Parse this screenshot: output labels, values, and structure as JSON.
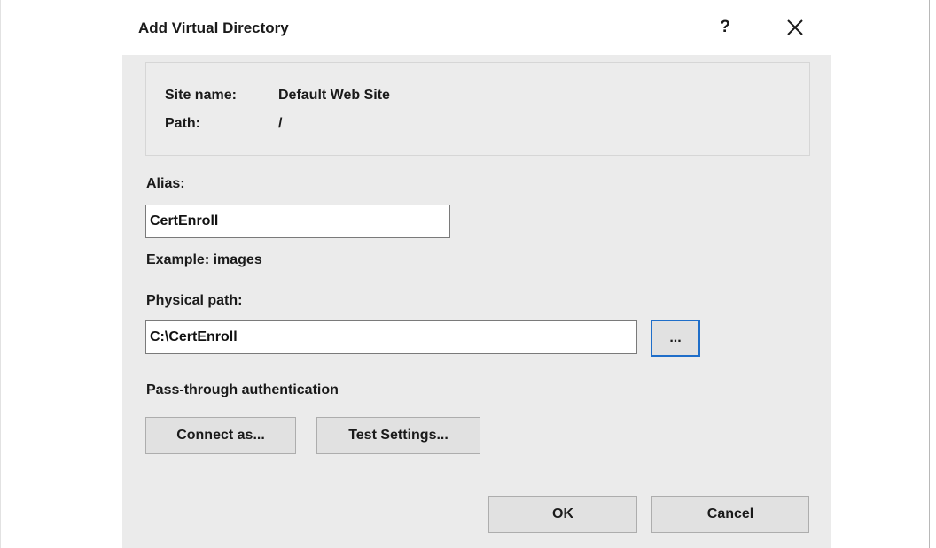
{
  "dialog": {
    "title": "Add Virtual Directory",
    "help_label": "?",
    "close_icon": "close-icon"
  },
  "site_info": {
    "site_name_label": "Site name:",
    "site_name_value": "Default Web Site",
    "path_label": "Path:",
    "path_value": "/"
  },
  "alias": {
    "label": "Alias:",
    "value": "CertEnroll",
    "example": "Example: images"
  },
  "physical_path": {
    "label": "Physical path:",
    "value": "C:\\CertEnroll",
    "browse_label": "..."
  },
  "auth": {
    "label": "Pass-through authentication",
    "connect_label": "Connect as...",
    "test_label": "Test Settings..."
  },
  "footer": {
    "ok_label": "OK",
    "cancel_label": "Cancel"
  },
  "colors": {
    "client_bg": "#ebebeb",
    "focus_border": "#1f6ec9"
  }
}
